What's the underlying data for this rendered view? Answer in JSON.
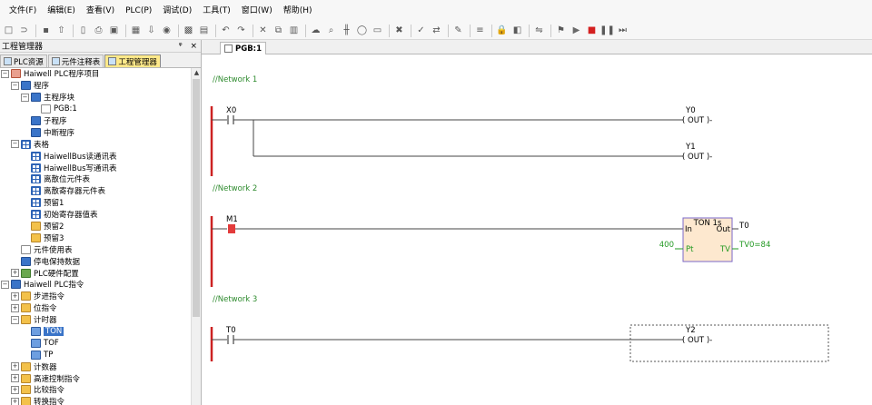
{
  "menu": [
    "文件(F)",
    "编辑(E)",
    "查看(V)",
    "PLC(P)",
    "调试(D)",
    "工具(T)",
    "窗口(W)",
    "帮助(H)"
  ],
  "toolbar_icons": [
    "new-icon",
    "open-icon",
    "sep",
    "save-icon",
    "upload-icon",
    "sep",
    "page-icon",
    "print-icon",
    "preview-icon",
    "sep",
    "plc-icon",
    "download-icon",
    "monitor-icon",
    "sep",
    "grid-icon",
    "table-icon",
    "sep",
    "undo-icon",
    "redo-icon",
    "sep",
    "cut-icon",
    "copy-icon",
    "paste-icon",
    "sep",
    "cloud-icon",
    "find-icon",
    "contact-icon",
    "coil-icon",
    "box-icon",
    "sep",
    "delete-icon",
    "sep",
    "compile-icon",
    "find-replace-icon",
    "sep",
    "comment-icon",
    "sep",
    "ladder-icon",
    "sep",
    "lock-icon",
    "unlock-icon",
    "sep",
    "transfer-icon",
    "sep",
    "run-mode-icon",
    "run-icon",
    "stop-icon",
    "pause-icon",
    "step-icon"
  ],
  "panel": {
    "title": "工程管理器",
    "pin": "ᵠ",
    "close": "×",
    "tabs": [
      "PLC资源",
      "元件注释表",
      "工程管理器"
    ],
    "tree": [
      {
        "level": 0,
        "toggle": "−",
        "icon": "ic-red",
        "label": "Haiwell PLC程序项目"
      },
      {
        "level": 1,
        "toggle": "−",
        "icon": "ic-blue",
        "label": "程序"
      },
      {
        "level": 2,
        "toggle": "−",
        "icon": "ic-blue",
        "label": "主程序块"
      },
      {
        "level": 3,
        "toggle": "",
        "icon": "ic-page",
        "label": "PGB:1"
      },
      {
        "level": 2,
        "toggle": "",
        "icon": "ic-blue",
        "label": "子程序"
      },
      {
        "level": 2,
        "toggle": "",
        "icon": "ic-blue",
        "label": "中断程序"
      },
      {
        "level": 1,
        "toggle": "−",
        "icon": "ic-grid",
        "label": "表格"
      },
      {
        "level": 2,
        "toggle": "",
        "icon": "ic-grid",
        "label": "HaiwellBus读通讯表"
      },
      {
        "level": 2,
        "toggle": "",
        "icon": "ic-grid",
        "label": "HaiwellBus写通讯表"
      },
      {
        "level": 2,
        "toggle": "",
        "icon": "ic-grid",
        "label": "离散位元件表"
      },
      {
        "level": 2,
        "toggle": "",
        "icon": "ic-grid",
        "label": "离散寄存器元件表"
      },
      {
        "level": 2,
        "toggle": "",
        "icon": "ic-grid",
        "label": "预留1"
      },
      {
        "level": 2,
        "toggle": "",
        "icon": "ic-grid",
        "label": "初始寄存器值表"
      },
      {
        "level": 2,
        "toggle": "",
        "icon": "ic-folder",
        "label": "预留2"
      },
      {
        "level": 2,
        "toggle": "",
        "icon": "ic-folder",
        "label": "预留3"
      },
      {
        "level": 1,
        "toggle": "",
        "icon": "ic-page",
        "label": "元件使用表"
      },
      {
        "level": 1,
        "toggle": "",
        "icon": "ic-blue",
        "label": "停电保持数据"
      },
      {
        "level": 1,
        "toggle": "+",
        "icon": "ic-chip",
        "label": "PLC硬件配置"
      },
      {
        "level": 0,
        "toggle": "−",
        "icon": "ic-blue",
        "label": "Haiwell PLC指令"
      },
      {
        "level": 1,
        "toggle": "+",
        "icon": "ic-folder",
        "label": "步进指令"
      },
      {
        "level": 1,
        "toggle": "+",
        "icon": "ic-folder",
        "label": "位指令"
      },
      {
        "level": 1,
        "toggle": "−",
        "icon": "ic-folder",
        "label": "计时器"
      },
      {
        "level": 2,
        "toggle": "",
        "icon": "ic-ton",
        "label": "TON",
        "selected": true
      },
      {
        "level": 2,
        "toggle": "",
        "icon": "ic-ton",
        "label": "TOF"
      },
      {
        "level": 2,
        "toggle": "",
        "icon": "ic-ton",
        "label": "TP"
      },
      {
        "level": 1,
        "toggle": "+",
        "icon": "ic-folder",
        "label": "计数器"
      },
      {
        "level": 1,
        "toggle": "+",
        "icon": "ic-folder",
        "label": "高速控制指令"
      },
      {
        "level": 1,
        "toggle": "+",
        "icon": "ic-folder",
        "label": "比较指令"
      },
      {
        "level": 1,
        "toggle": "+",
        "icon": "ic-folder",
        "label": "转换指令"
      }
    ]
  },
  "editor": {
    "tab": "PGB:1",
    "networks": [
      {
        "label": "//Network 1"
      },
      {
        "label": "//Network 2"
      },
      {
        "label": "//Network 3"
      }
    ],
    "rung1": {
      "contact": "X0",
      "coil1": "Y0",
      "coil2": "Y1",
      "coil_text": "( OUT )-"
    },
    "rung2": {
      "contact": "M1",
      "block_title": "TON 1s",
      "in": "In",
      "out": "Out",
      "pt": "Pt",
      "tv": "TV",
      "preset": "400",
      "out_name": "T0",
      "tv_value": "TV0=84"
    },
    "rung3": {
      "contact": "T0",
      "coil": "Y2",
      "coil_text": "( OUT )-"
    }
  },
  "colors": {
    "power_rail": "#cc2222",
    "network_label": "#2e8b2e",
    "wire": "#444444",
    "block_fill": "#fde8cf",
    "block_border": "#7b68c8",
    "value_green": "#229922",
    "selected": "#3a74c8"
  }
}
